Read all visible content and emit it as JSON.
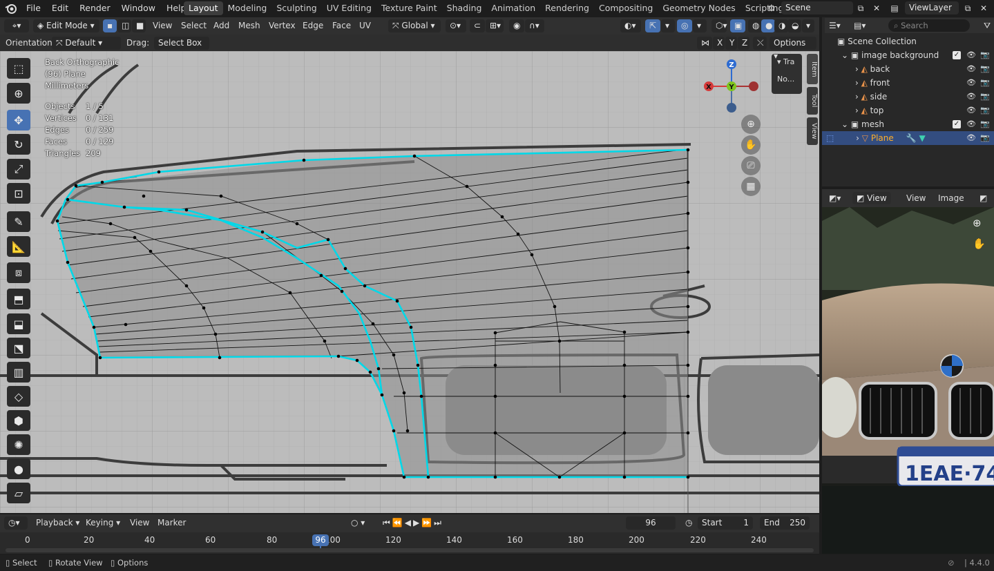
{
  "topmenu": {
    "items": [
      "File",
      "Edit",
      "Render",
      "Window",
      "Help"
    ]
  },
  "workspaces": [
    "Layout",
    "Modeling",
    "Sculpting",
    "UV Editing",
    "Texture Paint",
    "Shading",
    "Animation",
    "Rendering",
    "Compositing",
    "Geometry Nodes",
    "Scripting"
  ],
  "scene": {
    "name": "Scene",
    "view_layer": "ViewLayer"
  },
  "viewport_header": {
    "mode": "Edit Mode",
    "menus": [
      "View",
      "Select",
      "Add",
      "Mesh",
      "Vertex",
      "Edge",
      "Face",
      "UV"
    ],
    "transform_orientation": "Global"
  },
  "tool_header": {
    "orientation_label": "Orientation:",
    "orientation_value": "Default",
    "drag_label": "Drag:",
    "drag_value": "Select Box",
    "options_label": "Options",
    "axis_x": "X",
    "axis_y": "Y",
    "axis_z": "Z"
  },
  "overlay_info": {
    "view_name": "Back Orthographic",
    "object_name": "(96) Plane",
    "units": "Millimeters",
    "stats": [
      {
        "label": "Objects",
        "value": "1 / 5"
      },
      {
        "label": "Vertices",
        "value": "0 / 131"
      },
      {
        "label": "Edges",
        "value": "0 / 259"
      },
      {
        "label": "Faces",
        "value": "0 / 129"
      },
      {
        "label": "Triangles",
        "value": "209"
      }
    ]
  },
  "nav_gizmo": {
    "z": "Z",
    "y": "Y",
    "x": "X"
  },
  "npanel": {
    "tabs": [
      "Item",
      "Tool",
      "View"
    ],
    "transform_title": "Tra",
    "transform_value": "No..."
  },
  "outliner": {
    "search_placeholder": "Search",
    "scene_collection": "Scene Collection",
    "items": [
      {
        "name": "image background",
        "type": "collection"
      },
      {
        "name": "back",
        "type": "image"
      },
      {
        "name": "front",
        "type": "image"
      },
      {
        "name": "side",
        "type": "image"
      },
      {
        "name": "top",
        "type": "image"
      },
      {
        "name": "mesh",
        "type": "collection"
      },
      {
        "name": "Plane",
        "type": "mesh",
        "selected": true
      }
    ]
  },
  "image_editor": {
    "view_label": "View",
    "menus": [
      "View",
      "Image"
    ]
  },
  "timeline": {
    "menus": [
      "Playback",
      "Keying",
      "View",
      "Marker"
    ],
    "current_frame": "96",
    "start_label": "Start",
    "start_value": "1",
    "end_label": "End",
    "end_value": "250",
    "ruler": [
      "0",
      "20",
      "40",
      "60",
      "80",
      "100",
      "120",
      "140",
      "160",
      "180",
      "200",
      "220",
      "240"
    ],
    "playhead": "96"
  },
  "statusbar": {
    "items": [
      "Select",
      "Rotate View",
      "Options"
    ],
    "version": "4.4.0"
  },
  "colors": {
    "accent": "#4772b3",
    "mesh_edge": "#00d8e8",
    "background": "#1d1d1d",
    "header": "#303030"
  }
}
